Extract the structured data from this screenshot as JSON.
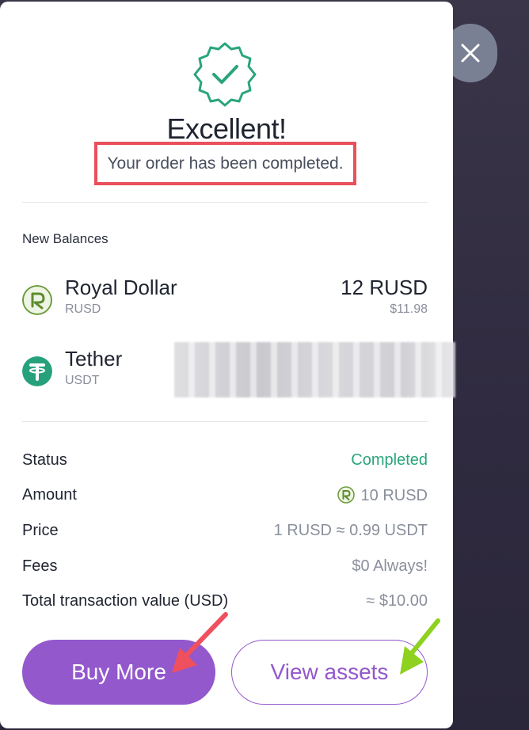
{
  "header": {
    "title": "Excellent!",
    "subtitle": "Your order has been completed."
  },
  "balances": {
    "label": "New Balances",
    "items": [
      {
        "name": "Royal Dollar",
        "code": "RUSD",
        "amount": "12 RUSD",
        "usd": "$11.98",
        "icon": "royal-dollar-icon",
        "color": "#6a9a3a"
      },
      {
        "name": "Tether",
        "code": "USDT",
        "amount": "",
        "usd": "",
        "icon": "tether-icon",
        "color": "#26a17b"
      }
    ]
  },
  "details": {
    "status_label": "Status",
    "status_value": "Completed",
    "amount_label": "Amount",
    "amount_value": "10 RUSD",
    "price_label": "Price",
    "price_value": "1 RUSD ≈ 0.99 USDT",
    "fees_label": "Fees",
    "fees_value": "$0 Always!",
    "total_label": "Total transaction value (USD)",
    "total_value": "≈ $10.00"
  },
  "actions": {
    "buy_more": "Buy More",
    "view_assets": "View assets"
  },
  "colors": {
    "accent": "#9358cc",
    "success": "#2aa57a",
    "highlight": "#e9505b",
    "arrow_red": "#f0505e",
    "arrow_green": "#8fd11f"
  }
}
